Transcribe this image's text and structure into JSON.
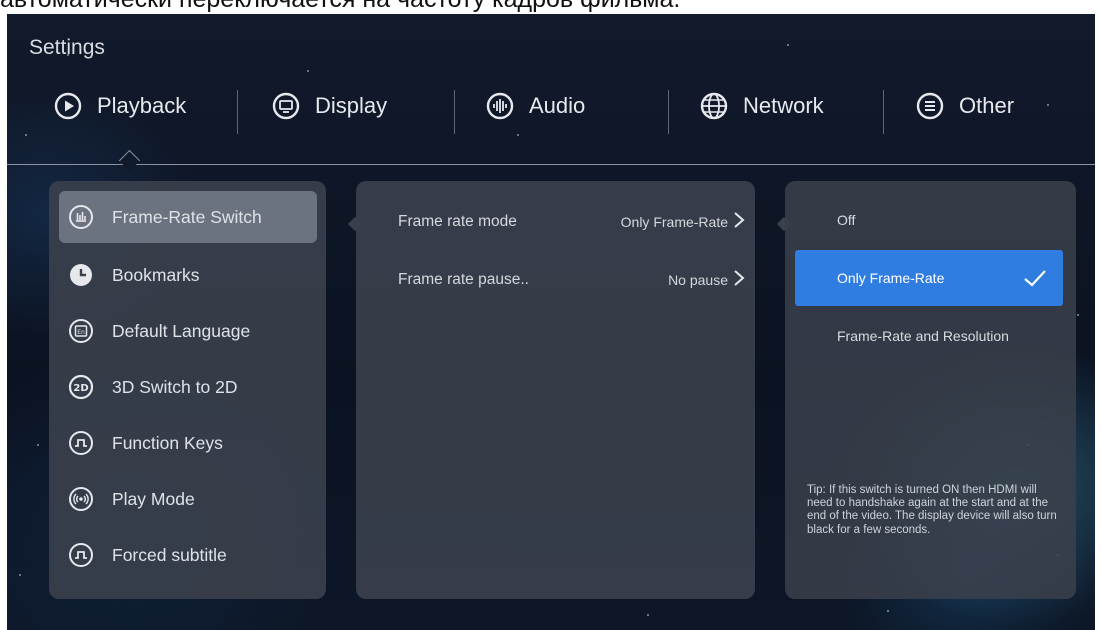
{
  "caption": "автоматически переключается на частоту кадров фильма.",
  "app": {
    "title": "Settings"
  },
  "tabs": [
    {
      "label": "Playback",
      "icon": "play-circle-icon"
    },
    {
      "label": "Display",
      "icon": "monitor-icon"
    },
    {
      "label": "Audio",
      "icon": "sound-wave-icon"
    },
    {
      "label": "Network",
      "icon": "globe-icon"
    },
    {
      "label": "Other",
      "icon": "menu-icon"
    }
  ],
  "active_tab": "Playback",
  "sidebar": {
    "items": [
      {
        "label": "Frame-Rate Switch",
        "icon": "chart-icon",
        "active": true
      },
      {
        "label": "Bookmarks",
        "icon": "clock-icon"
      },
      {
        "label": "Default Language",
        "icon": "language-icon"
      },
      {
        "label": "3D Switch to 2D",
        "icon": "2d-icon"
      },
      {
        "label": "Function Keys",
        "icon": "key-icon"
      },
      {
        "label": "Play Mode",
        "icon": "broadcast-icon"
      },
      {
        "label": "Forced subtitle",
        "icon": "subtitle-icon"
      }
    ]
  },
  "settings": [
    {
      "label": "Frame rate mode",
      "value": "Only Frame-Rate"
    },
    {
      "label": "Frame rate pause..",
      "value": "No pause"
    }
  ],
  "options": {
    "items": [
      {
        "label": "Off"
      },
      {
        "label": "Only Frame-Rate",
        "selected": true
      },
      {
        "label": "Frame-Rate and Resolution"
      }
    ],
    "tip": "Tip: If this switch is turned ON then HDMI will need to handshake again at the start and at the end of the video. The display device will also turn black for a few seconds."
  },
  "colors": {
    "accent": "#2f7de0",
    "panel": "#3a404c",
    "background": "#0d1727"
  }
}
